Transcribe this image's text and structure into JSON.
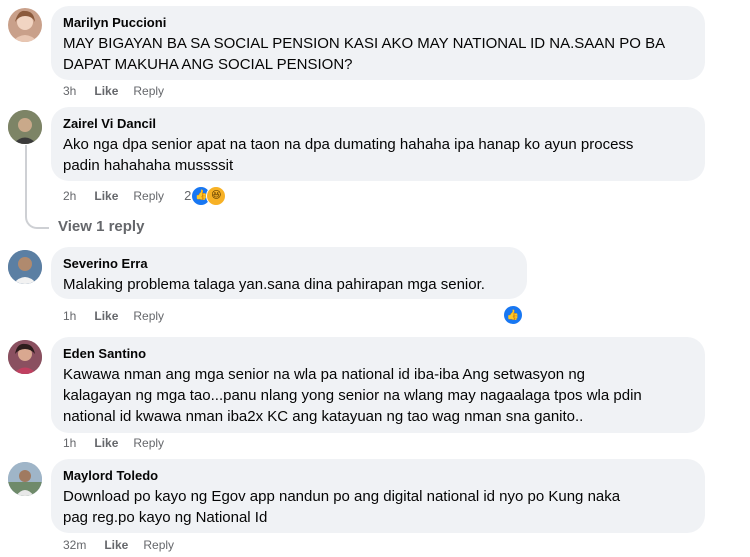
{
  "comments": [
    {
      "author": "Marilyn Puccioni",
      "text_lines": [
        "MAY BIGAYAN BA SA SOCIAL PENSION KASI AKO MAY NATIONAL ID NA.SAAN PO BA",
        "DAPAT MAKUHA ANG SOCIAL PENSION?"
      ],
      "time": "3h",
      "like": "Like",
      "reply": "Reply",
      "avatar_color": "#c9a08a"
    },
    {
      "author": "Zairel Vi Dancil",
      "text_lines": [
        "Ako nga dpa senior apat na taon na dpa dumating hahaha ipa hanap ko ayun process",
        "padin hahahaha mussssit"
      ],
      "time": "2h",
      "like": "Like",
      "reply": "Reply",
      "reaction_count": "2",
      "avatar_color": "#6a6f58"
    },
    {
      "author": "Severino Erra",
      "text_lines": [
        "Malaking problema talaga yan.sana dina pahirapan mga senior."
      ],
      "time": "1h",
      "like": "Like",
      "reply": "Reply",
      "avatar_color": "#4d6a8c"
    },
    {
      "author": "Eden Santino",
      "text_lines": [
        "Kawawa nman ang mga senior na wla pa national id iba-iba Ang setwasyon ng",
        "kalagayan ng mga tao...panu nlang yong senior na wlang may nagaalaga tpos wla pdin",
        "national id kwawa nman iba2x KC ang katayuan ng tao wag nman sna ganito.."
      ],
      "time": "1h",
      "like": "Like",
      "reply": "Reply",
      "avatar_color": "#7a4a55"
    },
    {
      "author": "Maylord Toledo",
      "text_lines": [
        "Download po kayo ng Egov app nandun po ang digital national id nyo po Kung naka",
        "pag reg.po kayo ng National Id"
      ],
      "time": "32m",
      "like": "Like",
      "reply": "Reply",
      "avatar_color": "#8aa0b8"
    }
  ],
  "view_replies": "View 1 reply",
  "colors": {
    "bubble": "#f0f2f5",
    "meta": "#65676b",
    "like_blue": "#1877f2"
  }
}
